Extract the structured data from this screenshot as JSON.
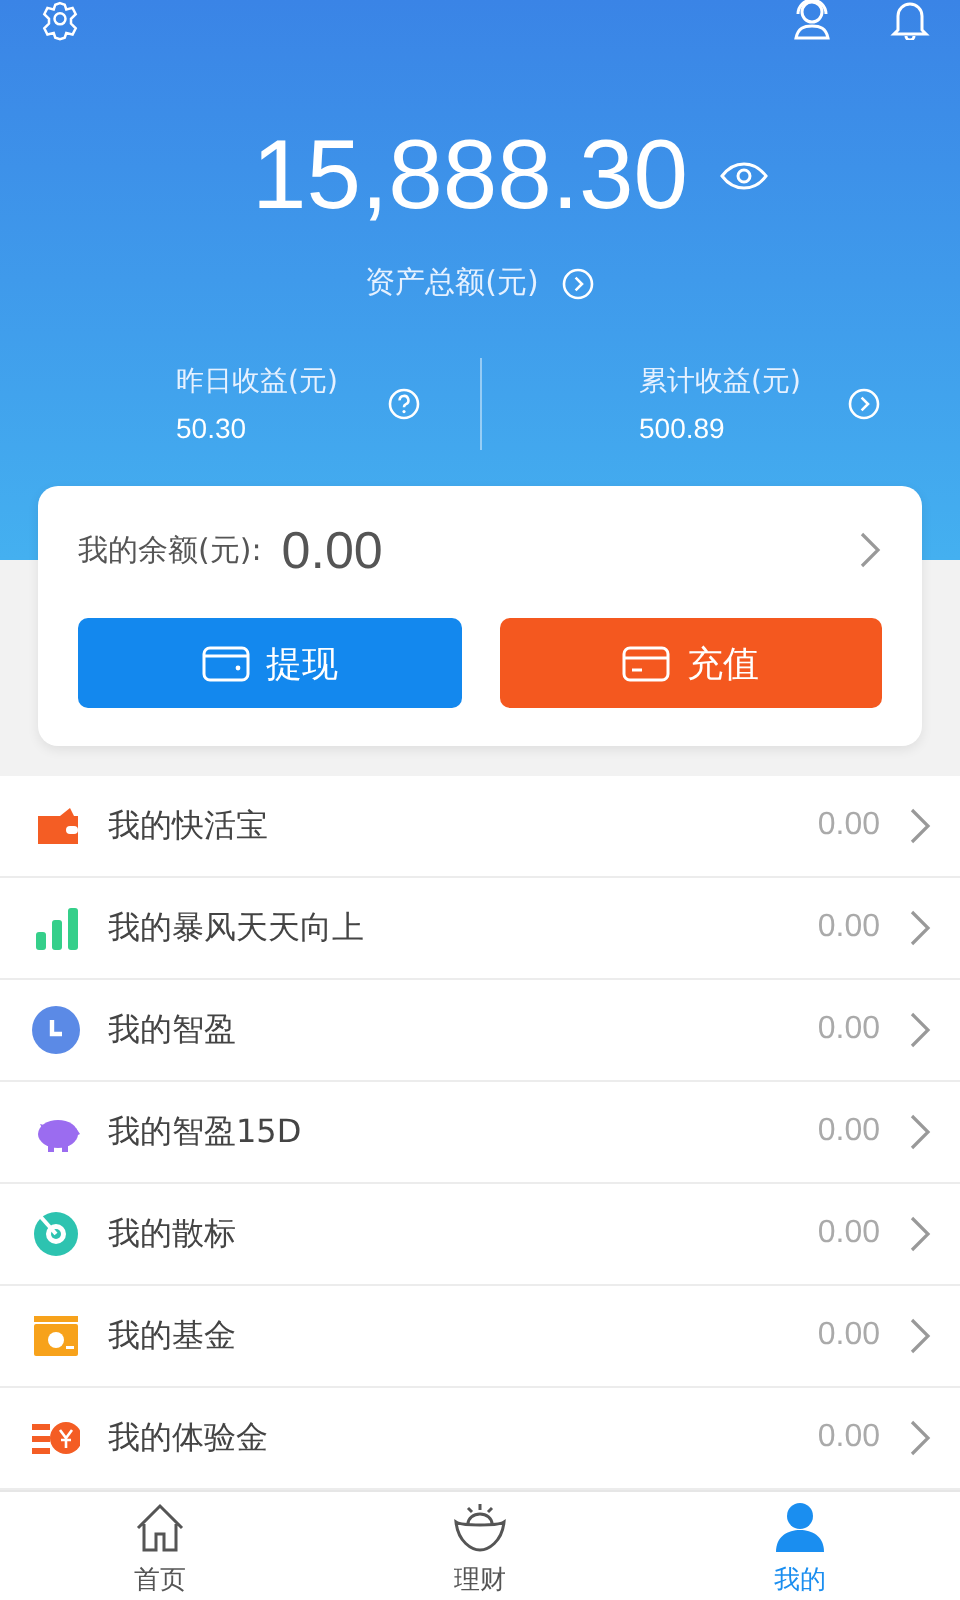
{
  "header": {
    "total_amount": "15,888.30",
    "total_label": "资产总额(元)",
    "stats": [
      {
        "label": "昨日收益(元)",
        "value": "50.30",
        "kind": "help"
      },
      {
        "label": "累计收益(元)",
        "value": "500.89",
        "kind": "more"
      }
    ]
  },
  "balance_card": {
    "label": "我的余额(元):",
    "value": "0.00",
    "buttons": [
      {
        "label": "提现",
        "kind": "withdraw"
      },
      {
        "label": "充值",
        "kind": "recharge"
      }
    ]
  },
  "items": [
    {
      "kind": "wallet",
      "name": "我的快活宝",
      "value": "0.00"
    },
    {
      "kind": "bars",
      "name": "我的暴风天天向上",
      "value": "0.00"
    },
    {
      "kind": "clock",
      "name": "我的智盈",
      "value": "0.00"
    },
    {
      "kind": "pig",
      "name": "我的智盈15D",
      "value": "0.00"
    },
    {
      "kind": "target",
      "name": "我的散标",
      "value": "0.00"
    },
    {
      "kind": "fund",
      "name": "我的基金",
      "value": "0.00"
    },
    {
      "kind": "coupon",
      "name": "我的体验金",
      "value": "0.00"
    }
  ],
  "tabs": [
    {
      "label": "首页",
      "kind": "home",
      "selected": false
    },
    {
      "label": "理财",
      "kind": "ingot",
      "selected": false
    },
    {
      "label": "我的",
      "kind": "person",
      "selected": true
    }
  ]
}
